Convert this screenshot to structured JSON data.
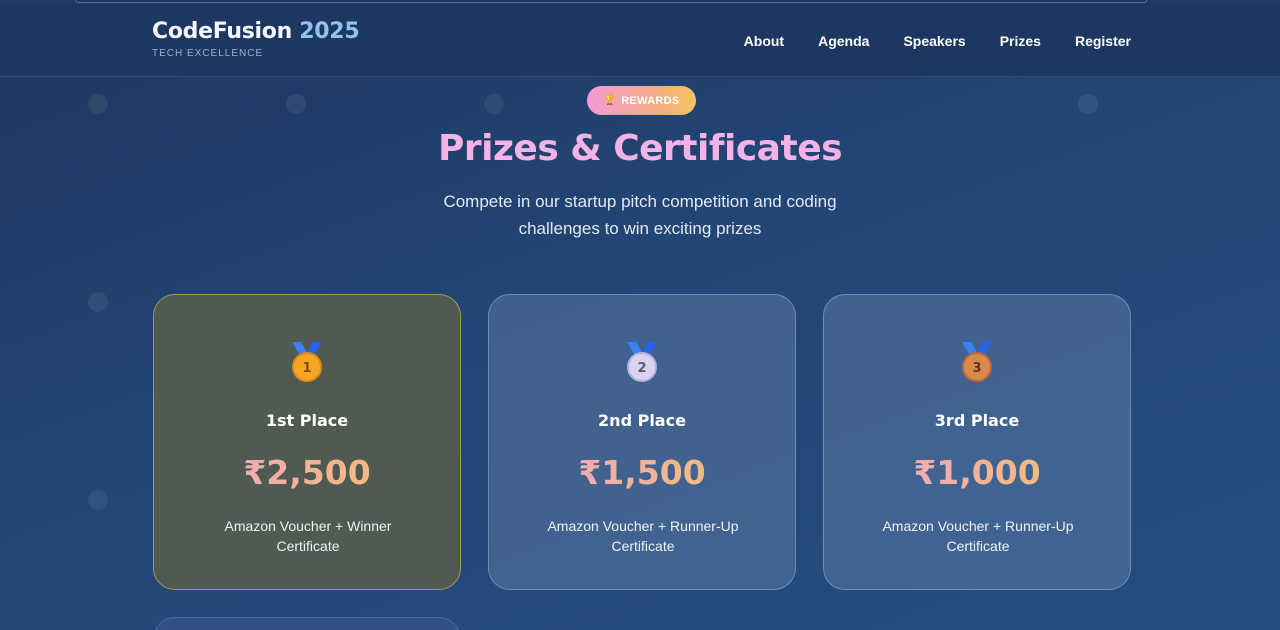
{
  "header": {
    "brand_main": "CodeFusion",
    "brand_year": "2025",
    "tagline": "TECH EXCELLENCE",
    "nav": [
      "About",
      "Agenda",
      "Speakers",
      "Prizes",
      "Register"
    ]
  },
  "section": {
    "badge_icon": "trophy-icon",
    "badge_label": "REWARDS",
    "title": "Prizes & Certificates",
    "subtitle": "Compete in our startup pitch competition and coding challenges to win exciting prizes"
  },
  "prizes": [
    {
      "medal": "gold-medal-icon",
      "medal_number": "1",
      "place": "1st Place",
      "amount": "₹2,500",
      "description": "Amazon Voucher + Winner Certificate"
    },
    {
      "medal": "silver-medal-icon",
      "medal_number": "2",
      "place": "2nd Place",
      "amount": "₹1,500",
      "description": "Amazon Voucher + Runner-Up Certificate"
    },
    {
      "medal": "bronze-medal-icon",
      "medal_number": "3",
      "place": "3rd Place",
      "amount": "₹1,000",
      "description": "Amazon Voucher + Runner-Up Certificate"
    }
  ],
  "colors": {
    "background": "#234675",
    "header": "#1d3760",
    "brand_accent": "#8fc3f2",
    "title": "#f4b3e6",
    "gold_card": "#4f5a52"
  }
}
